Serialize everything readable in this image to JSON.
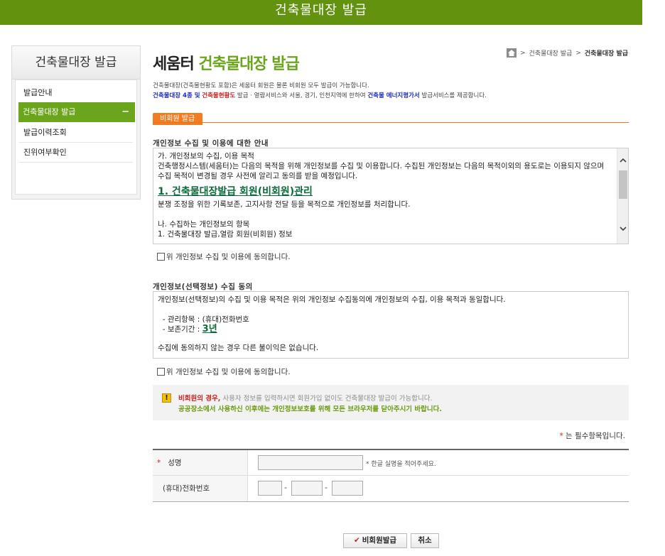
{
  "header": {
    "title": "건축물대장 발급"
  },
  "sidebar": {
    "title": "건축물대장 발급",
    "items": [
      {
        "label": "발급안내"
      },
      {
        "label": "건축물대장 발급",
        "active_icon": "−"
      },
      {
        "label": "발급이력조회"
      },
      {
        "label": "진위여부확인"
      }
    ]
  },
  "breadcrumb": {
    "items": [
      "건축물대장 발급",
      "건축물대장 발급"
    ],
    "separator": ">"
  },
  "page": {
    "title_prefix": "세움터",
    "title_accent": "건축물대장 발급",
    "desc_line1": "건축물대장(건축물현황도 포함)은 세움터 회원은 물론 비회원 모두 발급이 가능합니다.",
    "desc_line2_part1": "건축물대장 4종 및",
    "desc_line2_part2": "건축물현황도",
    "desc_line2_part3": "발급 · 열람서비스와 서울, 경기, 인천지역에 한하여",
    "desc_line2_part4": "건축물 에너지평가서",
    "desc_line2_part5": "발급서비스를 제공합니다."
  },
  "tab": {
    "label": "비회원 발급"
  },
  "privacy_section": {
    "title": "개인정보 수집 및 이용에 대한 안내",
    "para1": "가. 개인정보의 수집, 이용 목적\n건축행정시스템(세움터)는 다음의 목적을 위해 개인정보를 수집 및 이용합니다. 수집된 개인정보는 다음의 목적이외의 용도로는 이용되지 않으며 수집 목적이 변경될 경우 사전에 알리고 동의를 받을 예정입니다.",
    "heading": "1. 건축물대장발급 회원(비회원)관리",
    "para2": "분쟁 조정을 위한 기록보존, 고지사항 전달 등을 목적으로 개인정보를 처리합니다.\n\n나. 수집하는 개인정보의 항목\n1. 건축물대장 발급,열람 회원(비회원) 정보",
    "agree_label": "위 개인정보 수집 및 이용에 동의합니다."
  },
  "optional_section": {
    "title": "개인정보(선택정보) 수집 동의",
    "para1": "개인정보(선택정보)의 수집 및 이용 목적은 위의 개인정보 수집동의에 개인정보의 수집, 이용 목적과 동일합니다.",
    "item1": "  - 관리항목 : (휴대)전화번호",
    "item2_label": "  - 보존기간 : ",
    "item2_value": "3년",
    "para2": "수집에 동의하지 않는 경우 다른 불이익은 없습니다.",
    "agree_label": "위 개인정보 수집 및 이용에 동의합니다."
  },
  "notice": {
    "icon": "!",
    "line1_red": "비회원의 경우,",
    "line1_rest": "사용자 정보를 입력하시면 회원가입 없이도 건축물대장 발급이 가능합니다.",
    "line2": "공공장소에서 사용하신 이후에는 개인정보보호를 위해 모든 브라우저를 닫아주시기 바랍니다."
  },
  "required_note": {
    "star": "*",
    "text": "는 필수항목입니다."
  },
  "form": {
    "name": {
      "star": "*",
      "label": "성명",
      "value": "",
      "hint": "* 한글 실명을 적어주세요."
    },
    "phone": {
      "label": "(휴대)전화번호",
      "part1": "",
      "part2": "",
      "part3": "",
      "dash": "-"
    }
  },
  "buttons": {
    "submit": "비회원발급",
    "submit_icon": "✔",
    "cancel": "취소"
  },
  "colors": {
    "brand_green": "#63920f",
    "accent_green": "#6ba51c",
    "tab_orange": "#f47b20",
    "required_red": "#cc2222"
  },
  "icons": {
    "home": "home-icon",
    "warning": "warning-icon",
    "scroll_up": "chevron-up-icon",
    "scroll_down": "chevron-down-icon"
  }
}
